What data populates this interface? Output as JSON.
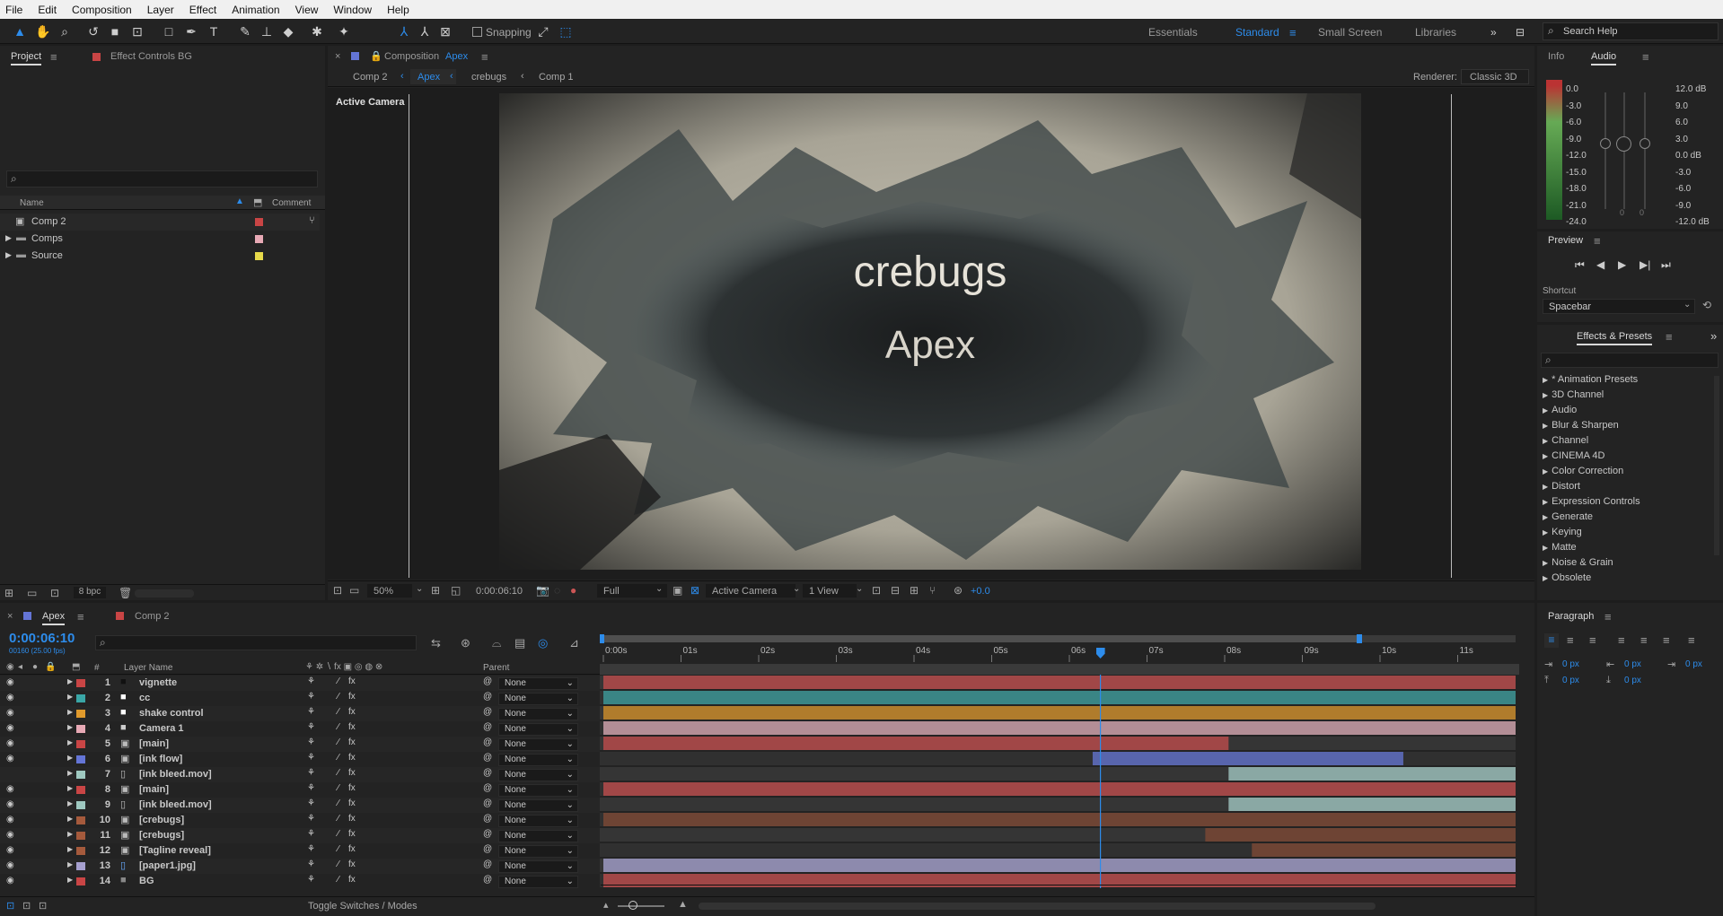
{
  "menu": [
    "File",
    "Edit",
    "Composition",
    "Layer",
    "Effect",
    "Animation",
    "View",
    "Window",
    "Help"
  ],
  "toolbar": {
    "snapping_label": "Snapping",
    "workspaces": [
      "Essentials",
      "Standard",
      "Small Screen",
      "Libraries"
    ],
    "active_workspace": "Standard",
    "search_help_placeholder": "Search Help"
  },
  "project_panel": {
    "tab_project": "Project",
    "tab_effect_controls": "Effect Controls BG",
    "col_name": "Name",
    "col_comment": "Comment",
    "items": [
      {
        "name": "Comp 2",
        "type": "comp",
        "color": "#c94545"
      },
      {
        "name": "Comps",
        "type": "folder",
        "color": "#e7a9b5"
      },
      {
        "name": "Source",
        "type": "folder",
        "color": "#e6d94a"
      }
    ],
    "bpc": "8 bpc"
  },
  "composition": {
    "tab_prefix": "Composition",
    "tab_name": "Apex",
    "breadcrumbs": [
      "Comp 2",
      "Apex",
      "crebugs",
      "Comp 1"
    ],
    "active_crumb": "Apex",
    "renderer_label": "Renderer:",
    "renderer_value": "Classic 3D",
    "view_label": "Active Camera",
    "canvas_title": "crebugs",
    "canvas_subtitle": "Apex",
    "footer": {
      "zoom": "50%",
      "timecode": "0:00:06:10",
      "resolution": "Full",
      "camera": "Active Camera",
      "views": "1 View",
      "exposure": "+0.0"
    }
  },
  "info_panel": {
    "tab_info": "Info",
    "tab_audio": "Audio",
    "left_db": [
      "0.0",
      "-3.0",
      "-6.0",
      "-9.0",
      "-12.0",
      "-15.0",
      "-18.0",
      "-21.0",
      "-24.0"
    ],
    "right_db": [
      "12.0 dB",
      "9.0",
      "6.0",
      "3.0",
      "0.0 dB",
      "-3.0",
      "-6.0",
      "-9.0",
      "-12.0 dB"
    ],
    "slider_zero_a": "0",
    "slider_zero_b": "0"
  },
  "preview_panel": {
    "title": "Preview",
    "shortcut_label": "Shortcut",
    "shortcut_value": "Spacebar"
  },
  "effects_panel": {
    "title": "Effects & Presets",
    "items": [
      "* Animation Presets",
      "3D Channel",
      "Audio",
      "Blur & Sharpen",
      "Channel",
      "CINEMA 4D",
      "Color Correction",
      "Distort",
      "Expression Controls",
      "Generate",
      "Keying",
      "Matte",
      "Noise & Grain",
      "Obsolete"
    ]
  },
  "paragraph_panel": {
    "title": "Paragraph",
    "indent_values": [
      "0 px",
      "0 px",
      "0 px",
      "0 px",
      "0 px"
    ]
  },
  "timeline": {
    "tab_active": "Apex",
    "tab_other": "Comp 2",
    "timecode": "0:00:06:10",
    "frame_info": "00160 (25.00 fps)",
    "col_layer_name": "Layer Name",
    "col_parent": "Parent",
    "col_num": "#",
    "ruler": [
      "0:00s",
      "01s",
      "02s",
      "03s",
      "04s",
      "05s",
      "06s",
      "07s",
      "08s",
      "09s",
      "10s",
      "11s"
    ],
    "toggle_label": "Toggle Switches / Modes",
    "current_time_sec": 6.4,
    "layers": [
      {
        "num": "1",
        "name": "vignette",
        "color": "#c94545",
        "icon": "solid",
        "bar_color": "#a14747",
        "start": 0,
        "end": 11.8,
        "eye": true
      },
      {
        "num": "2",
        "name": "cc",
        "color": "#3aa6a6",
        "icon": "solid-white",
        "bar_color": "#3a8585",
        "start": 0,
        "end": 11.8,
        "eye": true
      },
      {
        "num": "3",
        "name": "shake control",
        "color": "#e09a2c",
        "icon": "solid-white",
        "bar_color": "#b07c2c",
        "start": 0,
        "end": 11.8,
        "eye": true
      },
      {
        "num": "4",
        "name": "Camera 1",
        "color": "#e7a9b5",
        "icon": "camera",
        "bar_color": "#b38e96",
        "start": 0,
        "end": 11.8,
        "eye": true
      },
      {
        "num": "5",
        "name": "[main]",
        "color": "#c94545",
        "icon": "comp",
        "bar_color": "#a14747",
        "start": 0,
        "end": 8.05,
        "eye": true
      },
      {
        "num": "6",
        "name": "[ink flow]",
        "color": "#6475d6",
        "icon": "comp",
        "bar_color": "#5865ad",
        "start": 6.3,
        "end": 10.3,
        "eye": true
      },
      {
        "num": "7",
        "name": "[ink bleed.mov]",
        "color": "#9ec8c0",
        "icon": "footage",
        "bar_color": "#8aa8a4",
        "start": 8.05,
        "end": 11.8,
        "eye": false
      },
      {
        "num": "8",
        "name": "[main]",
        "color": "#c94545",
        "icon": "comp",
        "bar_color": "#a14747",
        "start": 0,
        "end": 11.8,
        "eye": true
      },
      {
        "num": "9",
        "name": "[ink bleed.mov]",
        "color": "#9ec8c0",
        "icon": "footage",
        "bar_color": "#8aa8a4",
        "start": 8.05,
        "end": 11.8,
        "eye": true
      },
      {
        "num": "10",
        "name": "[crebugs]",
        "color": "#a55a3c",
        "icon": "comp",
        "bar_color": "#6e4434",
        "start": 0,
        "end": 11.8,
        "eye": true
      },
      {
        "num": "11",
        "name": "[crebugs]",
        "color": "#a55a3c",
        "icon": "comp",
        "bar_color": "#6e4434",
        "start": 7.75,
        "end": 11.8,
        "eye": true
      },
      {
        "num": "12",
        "name": "[Tagline reveal]",
        "color": "#a55a3c",
        "icon": "comp",
        "bar_color": "#6e4434",
        "start": 8.35,
        "end": 11.8,
        "eye": true
      },
      {
        "num": "13",
        "name": "[paper1.jpg]",
        "color": "#a6a0cf",
        "icon": "image",
        "bar_color": "#8d8aad",
        "start": 0,
        "end": 11.8,
        "eye": true
      },
      {
        "num": "14",
        "name": "BG",
        "color": "#c94545",
        "icon": "solid-gray",
        "bar_color": "#a14747",
        "start": 0,
        "end": 11.8,
        "eye": true
      }
    ],
    "parent_value": "None"
  }
}
